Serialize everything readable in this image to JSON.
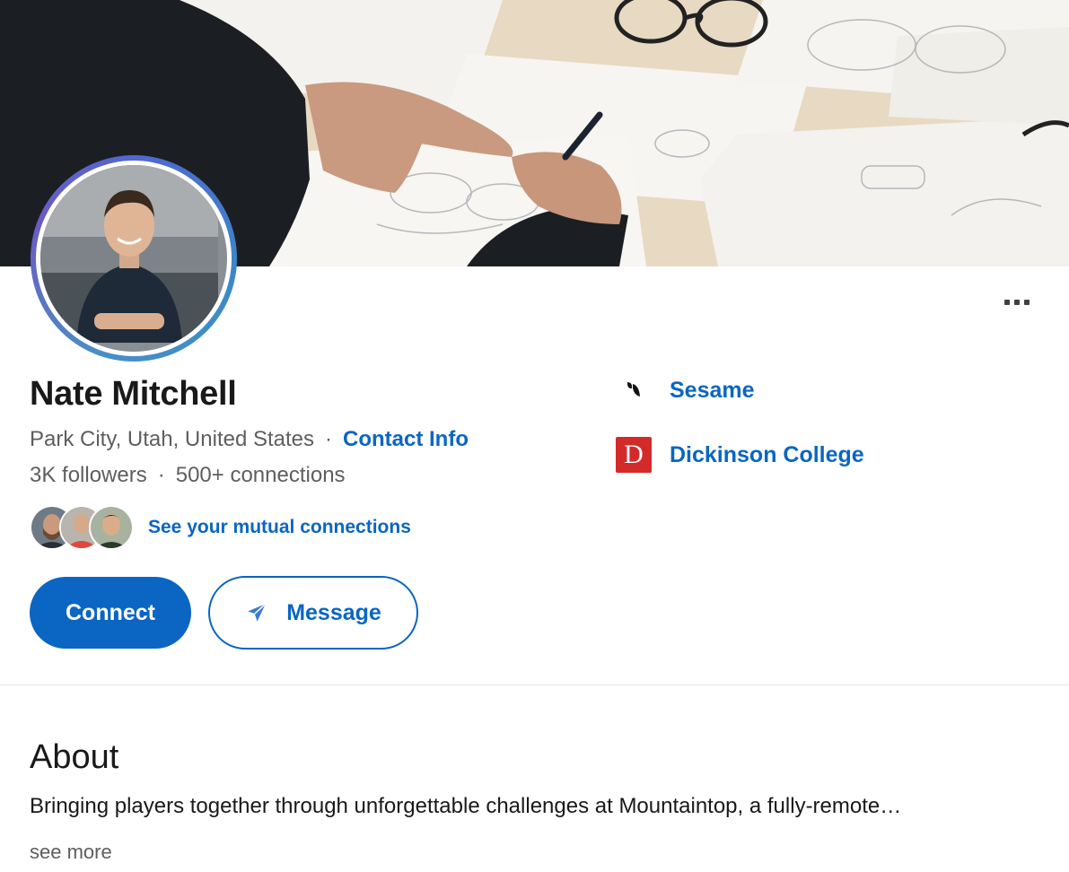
{
  "profile": {
    "name": "Nate Mitchell",
    "location": "Park City, Utah, United States",
    "location_separator": "·",
    "contact_info_label": "Contact Info",
    "followers": "3K followers",
    "stats_separator": "·",
    "connections": "500+ connections",
    "mutual_connections_label": "See your mutual connections",
    "more_icon": "ellipsis-icon"
  },
  "actions": {
    "connect_label": "Connect",
    "message_label": "Message",
    "message_icon": "send-icon"
  },
  "experience": [
    {
      "name": "Sesame",
      "logo_icon": "sesame-logo"
    },
    {
      "name": "Dickinson College",
      "logo_icon": "dickinson-logo",
      "logo_letter": "D"
    }
  ],
  "about": {
    "title": "About",
    "text": "Bringing players together through unforgettable challenges at Mountaintop, a fully-remote…",
    "see_more_label": "see more"
  },
  "colors": {
    "link_blue": "#0a66c2",
    "text_dark": "#191919",
    "text_muted": "#5e5e5e",
    "dickinson_red": "#d32a2a"
  }
}
